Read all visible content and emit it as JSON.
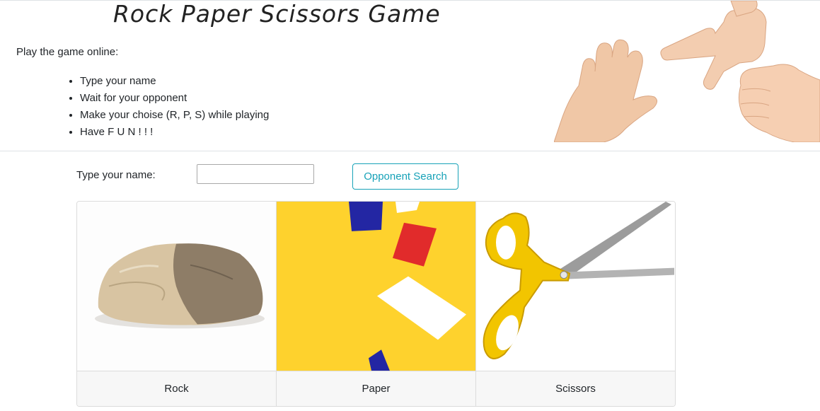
{
  "header": {
    "title": "Rock Paper Scissors Game",
    "intro": "Play the game online:",
    "rules": [
      "Type your name",
      "Wait for your opponent",
      "Make your choise (R, P, S) while playing",
      "Have F U N ! ! !"
    ]
  },
  "form": {
    "name_label": "Type your name:",
    "name_value": "",
    "search_button": "Opponent Search"
  },
  "choices": [
    {
      "label": "Rock",
      "icon": "rock-image"
    },
    {
      "label": "Paper",
      "icon": "paper-image"
    },
    {
      "label": "Scissors",
      "icon": "scissors-image"
    }
  ],
  "colors": {
    "accent": "#17a2b8",
    "paper_bg": "#fed22d",
    "scissors_handle": "#f2c500"
  }
}
